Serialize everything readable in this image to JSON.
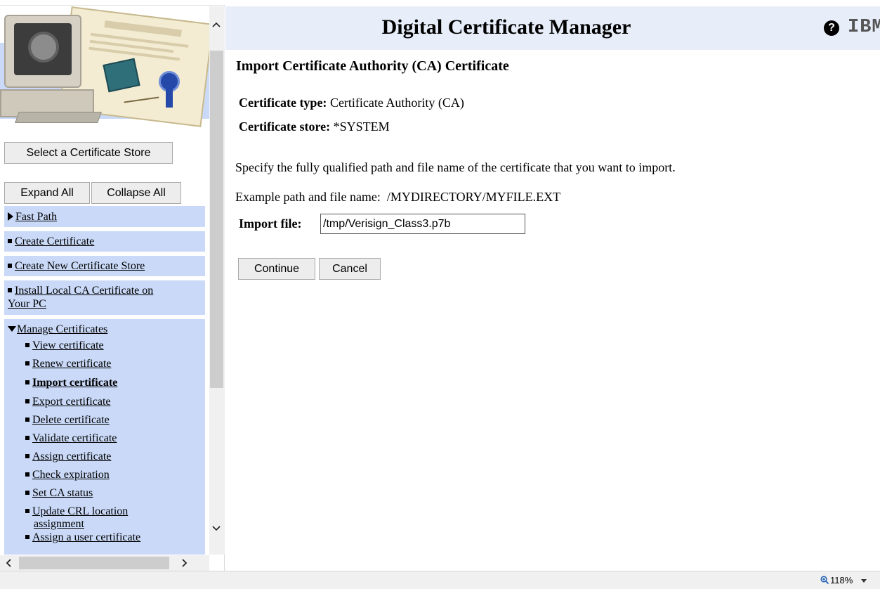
{
  "header": {
    "title": "Digital Certificate Manager",
    "help_icon": "question-circle-icon",
    "logo": "IBM",
    "logo_mark": "®"
  },
  "sidebar": {
    "select_store_label": "Select a Certificate Store",
    "expand_all_label": "Expand All",
    "collapse_all_label": "Collapse All",
    "items": [
      {
        "label": "Fast Path",
        "marker": "triangle-right"
      },
      {
        "label": "Create Certificate",
        "marker": "bullet"
      },
      {
        "label": "Create New Certificate Store",
        "marker": "bullet"
      },
      {
        "label": "Install Local CA Certificate on Your PC",
        "marker": "bullet"
      },
      {
        "label": "Manage Certificates",
        "marker": "triangle-down"
      }
    ],
    "install_line1": "Install Local CA Certificate on",
    "install_line2": "Your PC",
    "sub_items": [
      {
        "label": "View certificate"
      },
      {
        "label": "Renew certificate"
      },
      {
        "label": "Import certificate",
        "current": true
      },
      {
        "label": "Export certificate"
      },
      {
        "label": "Delete certificate"
      },
      {
        "label": "Validate certificate"
      },
      {
        "label": "Assign certificate"
      },
      {
        "label": "Check expiration"
      },
      {
        "label": "Set CA status"
      },
      {
        "label": "Update CRL location assignment"
      },
      {
        "label": "Assign a user certificate"
      }
    ],
    "update_line1": "Update CRL location",
    "update_line2": "assignment"
  },
  "main": {
    "heading": "Import Certificate Authority (CA) Certificate",
    "cert_type_label": "Certificate type:",
    "cert_type_value": "Certificate Authority (CA)",
    "cert_store_label": "Certificate store:",
    "cert_store_value": "*SYSTEM",
    "instructions": "Specify the fully qualified path and file name of the certificate that you want to import.",
    "example_label": "Example path and file name:",
    "example_value": "/MYDIRECTORY/MYFILE.EXT",
    "import_label": "Import file:",
    "import_value": "/tmp/Verisign_Class3.p7b",
    "continue_label": "Continue",
    "cancel_label": "Cancel"
  },
  "statusbar": {
    "zoom": "118%"
  },
  "colors": {
    "nav_background": "#c9d9f7",
    "header_background": "#e8eef9"
  }
}
